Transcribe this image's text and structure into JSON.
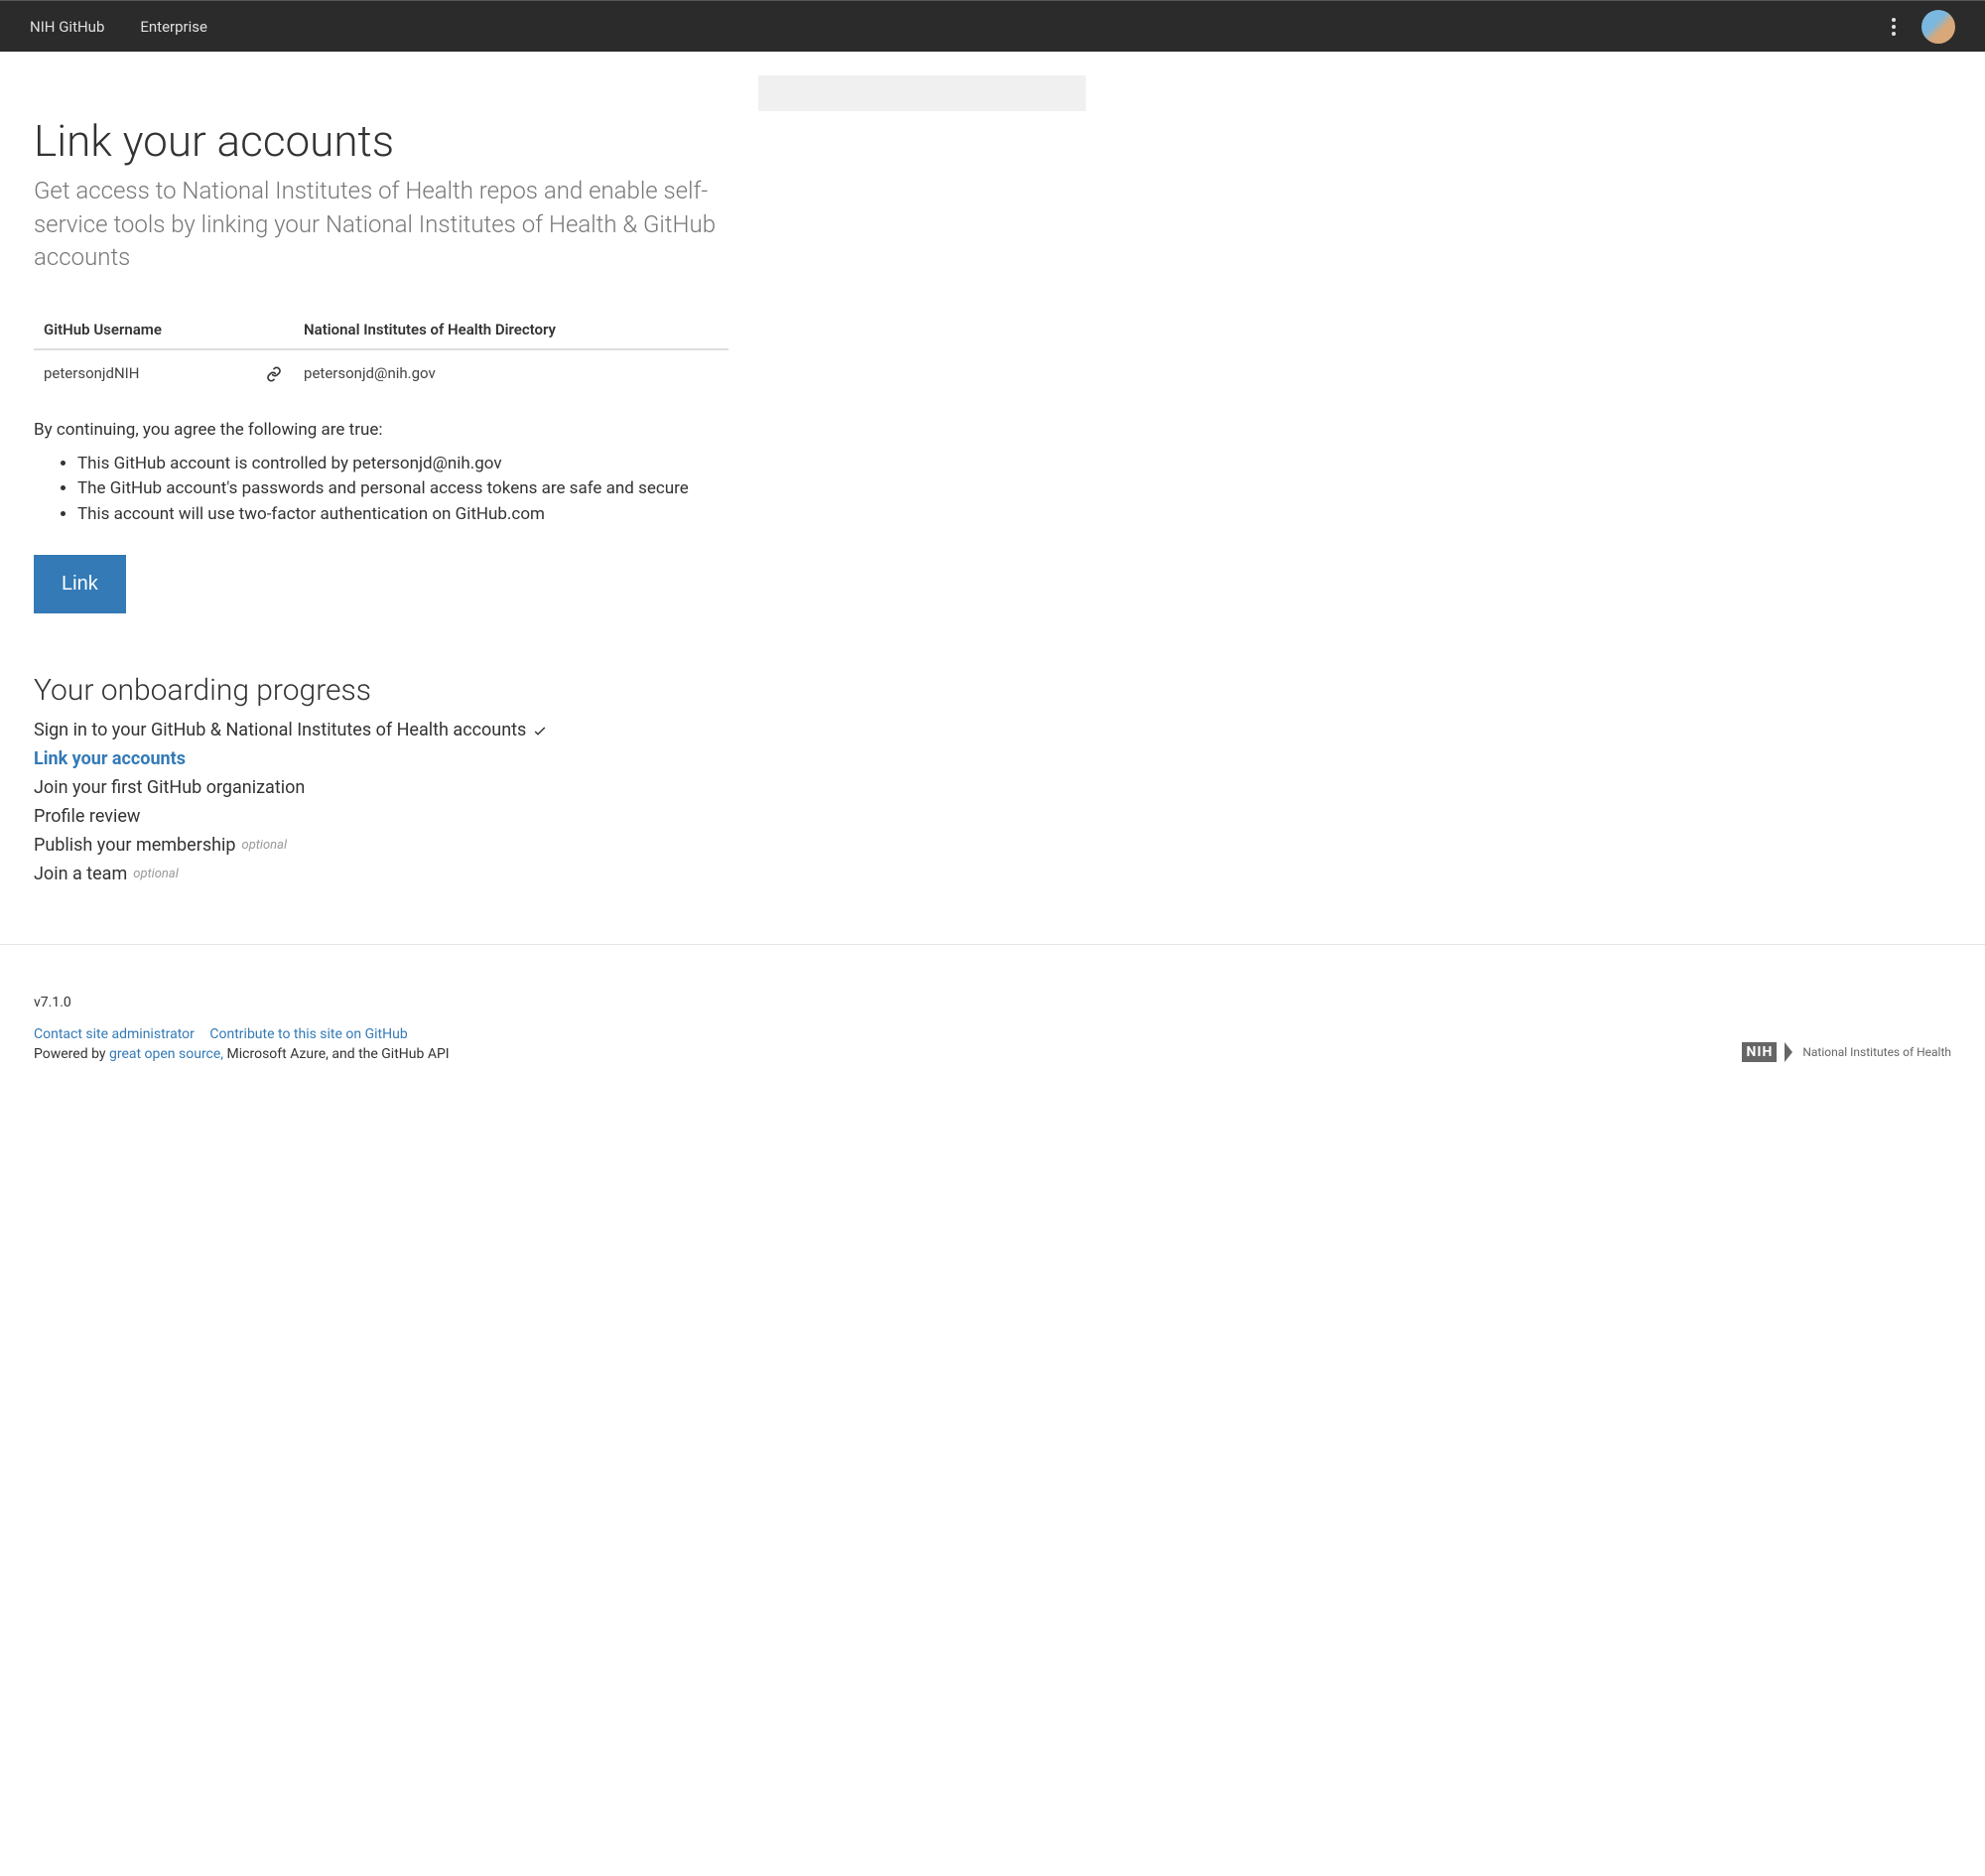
{
  "navbar": {
    "brand": "NIH GitHub",
    "enterprise": "Enterprise"
  },
  "page": {
    "title": "Link your accounts",
    "subtitle": "Get access to National Institutes of Health repos and enable self-service tools by linking your National Institutes of Health & GitHub accounts"
  },
  "table": {
    "header_github": "GitHub Username",
    "header_directory": "National Institutes of Health Directory",
    "github_username": "petersonjdNIH",
    "directory_value": "petersonjd@nih.gov"
  },
  "agreement": {
    "intro": "By continuing, you agree the following are true:",
    "items": [
      "This GitHub account is controlled by petersonjd@nih.gov",
      "The GitHub account's passwords and personal access tokens are safe and secure",
      "This account will use two-factor authentication on GitHub.com"
    ]
  },
  "buttons": {
    "link": "Link"
  },
  "onboarding": {
    "heading": "Your onboarding progress",
    "steps": [
      {
        "label": "Sign in to your GitHub & National Institutes of Health accounts",
        "done": true
      },
      {
        "label": "Link your accounts",
        "active": true
      },
      {
        "label": "Join your first GitHub organization"
      },
      {
        "label": "Profile review"
      },
      {
        "label": "Publish your membership",
        "optional": "optional"
      },
      {
        "label": "Join a team",
        "optional": "optional"
      }
    ]
  },
  "footer": {
    "version": "v7.1.0",
    "contact": "Contact site administrator",
    "contribute": "Contribute to this site on GitHub",
    "powered_prefix": "Powered by ",
    "powered_link": "great open source,",
    "powered_suffix": " Microsoft Azure, and the GitHub API",
    "logo_short": "NIH",
    "logo_text": "National Institutes of Health"
  }
}
